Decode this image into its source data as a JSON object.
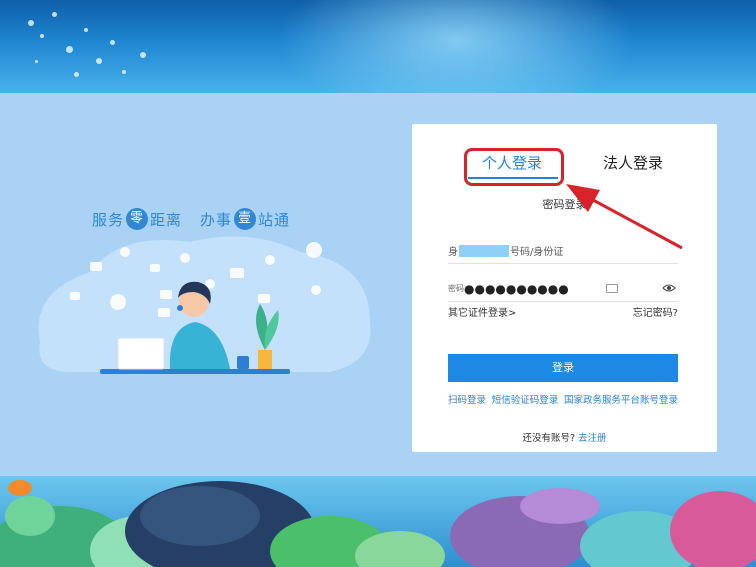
{
  "slogan": {
    "part1_pre": "服务",
    "part1_circle": "零",
    "part1_post": "距离",
    "part2_pre": "办事",
    "part2_circle": "壹",
    "part2_post": "站通"
  },
  "login": {
    "tabs": [
      {
        "label": "个人登录",
        "active": true
      },
      {
        "label": "法人登录",
        "active": false
      }
    ],
    "subtab": "密码登录",
    "username": {
      "prefix": "身",
      "suffix": "号码/身份证"
    },
    "password": {
      "prefix": "密码",
      "masked": "●●●●●●●●●●"
    },
    "other_cert_link": "其它证件登录>",
    "forgot_link": "忘记密码?",
    "submit_label": "登录",
    "alt_logins": [
      "扫码登录",
      "短信验证码登录",
      "国家政务服务平台账号登录"
    ],
    "register_text": "还没有账号?",
    "register_link": "去注册"
  },
  "colors": {
    "accent": "#2680d9",
    "button": "#1e88e5",
    "annotation": "#d8232a",
    "background": "#a9d2f5"
  }
}
